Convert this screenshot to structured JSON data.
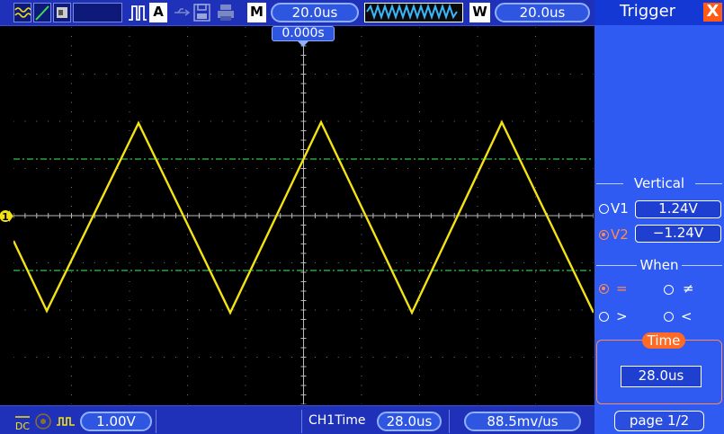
{
  "topbar": {
    "mode_badge": "A",
    "main_badge": "M",
    "main_timebase": "20.0us",
    "window_badge": "W",
    "window_timebase": "20.0us",
    "trigger_position": "0.000s"
  },
  "bottombar": {
    "coupling": "DC",
    "ch1_scale": "1.00V",
    "measure_label": "CH1Time",
    "measure_value": "28.0us",
    "slope_value": "88.5mv/us"
  },
  "channel_marker": "1",
  "menu": {
    "title": "Trigger",
    "close_label": "X",
    "vertical": {
      "heading": "Vertical",
      "v1_label": "V1",
      "v1_value": "1.24V",
      "v2_label": "V2",
      "v2_value": "−1.24V",
      "selected": "V2"
    },
    "when": {
      "heading": "When",
      "options": [
        "=",
        "≠",
        ">",
        "<"
      ],
      "selected": "="
    },
    "time": {
      "heading": "Time",
      "value": "28.0us"
    },
    "page_label": "page 1/2"
  },
  "colors": {
    "trace": "#f4e312",
    "cursor": "#2fc74e",
    "grid": "#b9b9b9",
    "accent": "#ff6a26",
    "menu_bg": "#2f5bf2",
    "bar_bg": "#1f31b8"
  }
}
